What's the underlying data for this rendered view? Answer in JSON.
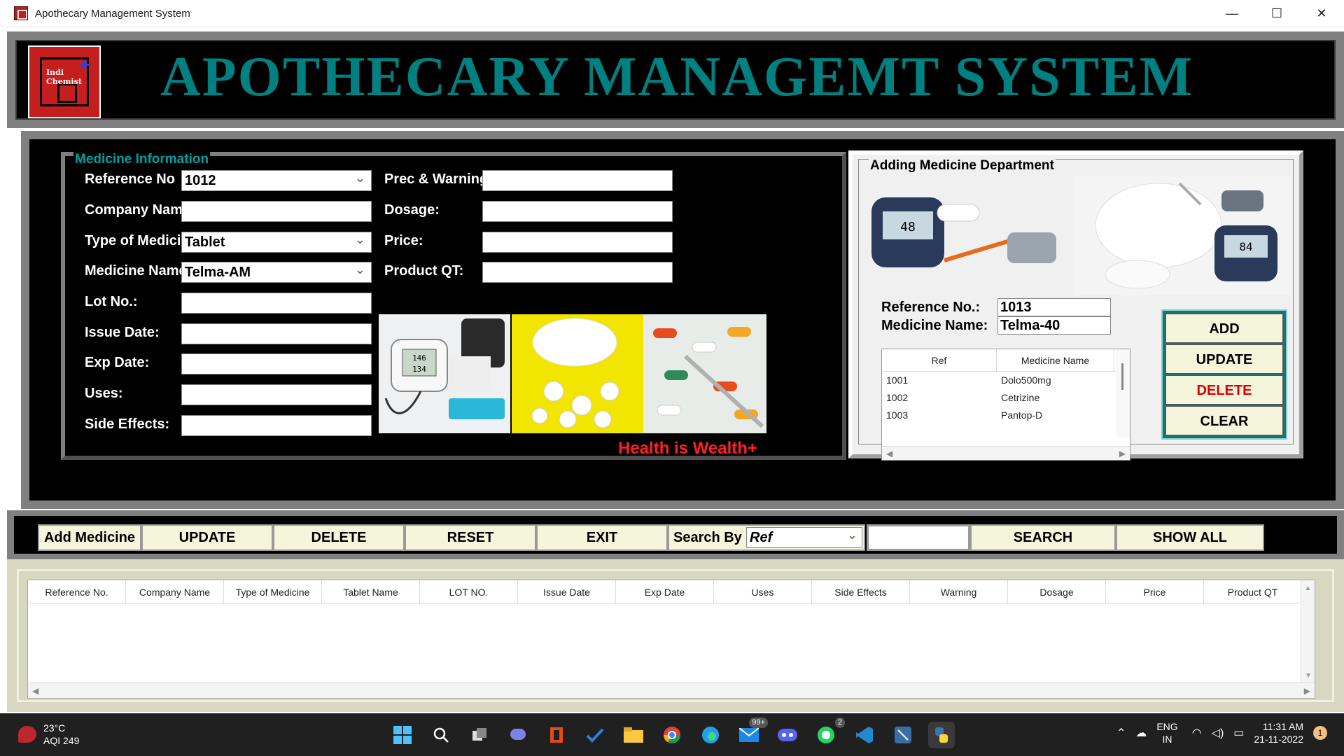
{
  "window": {
    "title": "Apothecary Management System",
    "minimize": "—",
    "maximize": "☐",
    "close": "✕"
  },
  "header": {
    "logo_text": "Indi Chemist",
    "logo_cross": "+",
    "title": "APOTHECARY MANAGEMT SYSTEM"
  },
  "medicine_info": {
    "legend": "Medicine Information",
    "left_fields": [
      {
        "label": "Reference No",
        "value": "1012",
        "combo": true
      },
      {
        "label": "Company Name :",
        "value": "",
        "combo": false
      },
      {
        "label": "Type of Medicine",
        "value": "Tablet",
        "combo": true
      },
      {
        "label": "Medicine Name",
        "value": "Telma-AM",
        "combo": true
      },
      {
        "label": "Lot No.:",
        "value": "",
        "combo": false
      },
      {
        "label": "Issue Date:",
        "value": "",
        "combo": false
      },
      {
        "label": "Exp Date:",
        "value": "",
        "combo": false
      },
      {
        "label": "Uses:",
        "value": "",
        "combo": false
      },
      {
        "label": "Side Effects:",
        "value": "",
        "combo": false
      }
    ],
    "right_fields": [
      {
        "label": "Prec & Warning",
        "value": ""
      },
      {
        "label": "Dosage:",
        "value": ""
      },
      {
        "label": "Price:",
        "value": ""
      },
      {
        "label": "Product QT:",
        "value": ""
      }
    ],
    "images": [
      {
        "name": "blood-pressure-monitor-image",
        "screen_reading_top": "146",
        "screen_reading_bottom": "134"
      },
      {
        "name": "pills-bottle-image"
      },
      {
        "name": "capsules-thermometer-image"
      }
    ],
    "slogan": "Health is Wealth+"
  },
  "add_department": {
    "legend": "Adding Medicine Department",
    "images": [
      {
        "name": "glucose-meter-image",
        "meter_reading": "48"
      },
      {
        "name": "sugar-bowl-meter-image",
        "meter_reading": "84"
      }
    ],
    "reference_label": "Reference No.:",
    "reference_value": "1013",
    "name_label": "Medicine Name:",
    "name_value": "Telma-40",
    "table": {
      "headers": [
        "Ref",
        "Medicine Name"
      ],
      "rows": [
        {
          "ref": "1001",
          "name": "Dolo500mg"
        },
        {
          "ref": "1002",
          "name": "Cetrizine"
        },
        {
          "ref": "1003",
          "name": "Pantop-D"
        }
      ]
    },
    "buttons": {
      "add": "ADD",
      "update": "UPDATE",
      "delete": "DELETE",
      "clear": "CLEAR"
    },
    "colors": {
      "delete_text": "#e00000"
    }
  },
  "button_bar": {
    "add_medicine": "Add Medicine",
    "update": "UPDATE",
    "delete": "DELETE",
    "reset": "RESET",
    "exit": "EXIT",
    "search_by_label": "Search By",
    "search_by_value": "Ref",
    "search_value": "",
    "search": "SEARCH",
    "show_all": "SHOW ALL"
  },
  "data_table": {
    "headers": [
      "Reference No.",
      "Company Name",
      "Type of Medicine",
      "Tablet Name",
      "LOT NO.",
      "Issue Date",
      "Exp Date",
      "Uses",
      "Side Effects",
      "Warning",
      "Dosage",
      "Price",
      "Product QT"
    ],
    "rows": [],
    "scroll_up": "▲",
    "scroll_down": "▼",
    "scroll_left": "◀",
    "scroll_right": "▶"
  },
  "taskbar": {
    "temperature": "23°C",
    "aqi": "AQI 249",
    "badges": {
      "mail": "99+",
      "whatsapp": "2"
    },
    "language": "ENG",
    "region": "IN",
    "time": "11:31 AM",
    "date": "21-11-2022",
    "notifications": "1"
  },
  "colors": {
    "title_teal": "#008080",
    "legend_teal": "#00a0a0",
    "slogan_red": "#ff2020",
    "button_bg": "#f5f5dc"
  }
}
